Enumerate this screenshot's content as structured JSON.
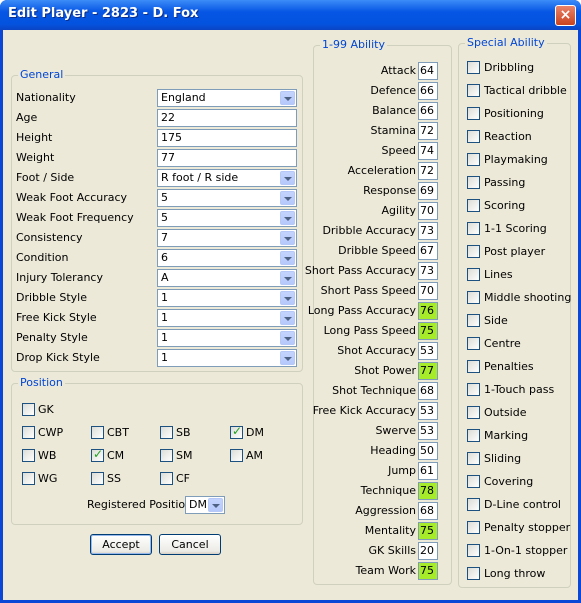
{
  "window": {
    "title": "Edit Player - 2823 - D. Fox",
    "close_glyph": "×"
  },
  "general": {
    "legend": "General",
    "fields": [
      {
        "label": "Nationality",
        "value": "England",
        "dropdown": true
      },
      {
        "label": "Age",
        "value": "22",
        "dropdown": false
      },
      {
        "label": "Height",
        "value": "175",
        "dropdown": false
      },
      {
        "label": "Weight",
        "value": "77",
        "dropdown": false
      },
      {
        "label": "Foot / Side",
        "value": "R foot / R side",
        "dropdown": true
      },
      {
        "label": "Weak Foot Accuracy",
        "value": "5",
        "dropdown": true
      },
      {
        "label": "Weak Foot Frequency",
        "value": "5",
        "dropdown": true
      },
      {
        "label": "Consistency",
        "value": "7",
        "dropdown": true
      },
      {
        "label": "Condition",
        "value": "6",
        "dropdown": true
      },
      {
        "label": "Injury Tolerancy",
        "value": "A",
        "dropdown": true
      },
      {
        "label": "Dribble Style",
        "value": "1",
        "dropdown": true
      },
      {
        "label": "Free Kick Style",
        "value": "1",
        "dropdown": true
      },
      {
        "label": "Penalty Style",
        "value": "1",
        "dropdown": true
      },
      {
        "label": "Drop Kick Style",
        "value": "1",
        "dropdown": true
      }
    ]
  },
  "position": {
    "legend": "Position",
    "options": [
      {
        "label": "GK",
        "checked": false
      },
      {
        "label": "CWP",
        "checked": false
      },
      {
        "label": "CBT",
        "checked": false
      },
      {
        "label": "SB",
        "checked": false
      },
      {
        "label": "DM",
        "checked": true
      },
      {
        "label": "WB",
        "checked": false
      },
      {
        "label": "CM",
        "checked": true
      },
      {
        "label": "SM",
        "checked": false
      },
      {
        "label": "AM",
        "checked": false
      },
      {
        "label": "WG",
        "checked": false
      },
      {
        "label": "SS",
        "checked": false
      },
      {
        "label": "CF",
        "checked": false
      }
    ],
    "registered_label": "Registered Position",
    "registered_value": "DM"
  },
  "ability": {
    "legend": "1-99 Ability",
    "highlight_color": "#a6ec2a",
    "stats": [
      {
        "label": "Attack",
        "value": "64",
        "high": false
      },
      {
        "label": "Defence",
        "value": "66",
        "high": false
      },
      {
        "label": "Balance",
        "value": "66",
        "high": false
      },
      {
        "label": "Stamina",
        "value": "72",
        "high": false
      },
      {
        "label": "Speed",
        "value": "74",
        "high": false
      },
      {
        "label": "Acceleration",
        "value": "72",
        "high": false
      },
      {
        "label": "Response",
        "value": "69",
        "high": false
      },
      {
        "label": "Agility",
        "value": "70",
        "high": false
      },
      {
        "label": "Dribble Accuracy",
        "value": "73",
        "high": false
      },
      {
        "label": "Dribble Speed",
        "value": "67",
        "high": false
      },
      {
        "label": "Short Pass Accuracy",
        "value": "73",
        "high": false
      },
      {
        "label": "Short Pass Speed",
        "value": "70",
        "high": false
      },
      {
        "label": "Long Pass Accuracy",
        "value": "76",
        "high": true
      },
      {
        "label": "Long Pass Speed",
        "value": "75",
        "high": true
      },
      {
        "label": "Shot Accuracy",
        "value": "53",
        "high": false
      },
      {
        "label": "Shot Power",
        "value": "77",
        "high": true
      },
      {
        "label": "Shot Technique",
        "value": "68",
        "high": false
      },
      {
        "label": "Free Kick Accuracy",
        "value": "53",
        "high": false
      },
      {
        "label": "Swerve",
        "value": "53",
        "high": false
      },
      {
        "label": "Heading",
        "value": "50",
        "high": false
      },
      {
        "label": "Jump",
        "value": "61",
        "high": false
      },
      {
        "label": "Technique",
        "value": "78",
        "high": true
      },
      {
        "label": "Aggression",
        "value": "68",
        "high": false
      },
      {
        "label": "Mentality",
        "value": "75",
        "high": true
      },
      {
        "label": "GK Skills",
        "value": "20",
        "high": false
      },
      {
        "label": "Team Work",
        "value": "75",
        "high": true
      }
    ]
  },
  "special": {
    "legend": "Special Ability",
    "items": [
      {
        "label": "Dribbling",
        "checked": false
      },
      {
        "label": "Tactical dribble",
        "checked": false
      },
      {
        "label": "Positioning",
        "checked": false
      },
      {
        "label": "Reaction",
        "checked": false
      },
      {
        "label": "Playmaking",
        "checked": false
      },
      {
        "label": "Passing",
        "checked": false
      },
      {
        "label": "Scoring",
        "checked": false
      },
      {
        "label": "1-1 Scoring",
        "checked": false
      },
      {
        "label": "Post player",
        "checked": false
      },
      {
        "label": "Lines",
        "checked": false
      },
      {
        "label": "Middle shooting",
        "checked": false
      },
      {
        "label": "Side",
        "checked": false
      },
      {
        "label": "Centre",
        "checked": false
      },
      {
        "label": "Penalties",
        "checked": false
      },
      {
        "label": "1-Touch pass",
        "checked": false
      },
      {
        "label": "Outside",
        "checked": false
      },
      {
        "label": "Marking",
        "checked": false
      },
      {
        "label": "Sliding",
        "checked": false
      },
      {
        "label": "Covering",
        "checked": false
      },
      {
        "label": "D-Line control",
        "checked": false
      },
      {
        "label": "Penalty stopper",
        "checked": false
      },
      {
        "label": "1-On-1 stopper",
        "checked": false
      },
      {
        "label": "Long throw",
        "checked": false
      }
    ]
  },
  "buttons": {
    "accept": "Accept",
    "cancel": "Cancel"
  }
}
